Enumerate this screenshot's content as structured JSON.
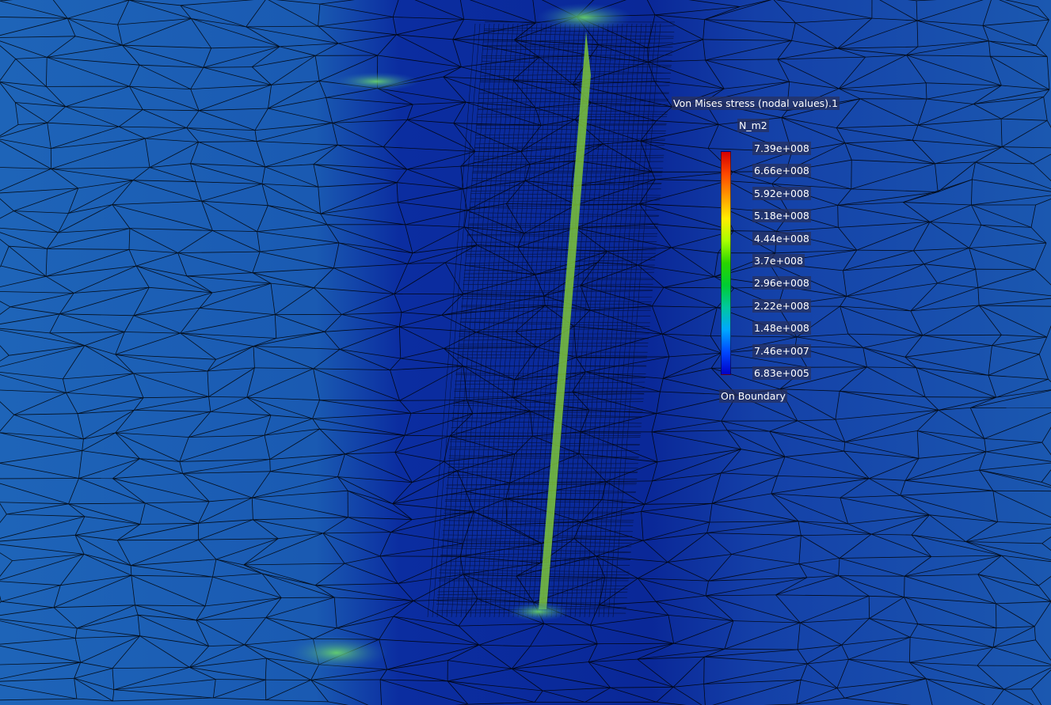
{
  "viewer": {
    "result_title": "Von Mises stress (nodal values).1",
    "unit": "N_m2",
    "location": "On Boundary"
  },
  "legend": {
    "values": [
      "7.39e+008",
      "6.66e+008",
      "5.92e+008",
      "5.18e+008",
      "4.44e+008",
      "3.7e+008",
      "2.96e+008",
      "2.22e+008",
      "1.48e+008",
      "7.46e+007",
      "6.83e+005"
    ],
    "colors": [
      "#d40000",
      "#ff4800",
      "#ff9a00",
      "#ffee00",
      "#a8ff00",
      "#2ad400",
      "#00cc33",
      "#00c8a0",
      "#00a8ff",
      "#0048ff",
      "#0000c8"
    ]
  },
  "colors": {
    "background": "#1f5fb5",
    "low_stress": "#0a2fa8",
    "mesh_line": "#000000",
    "crack_highlight": "#8fd12e"
  }
}
